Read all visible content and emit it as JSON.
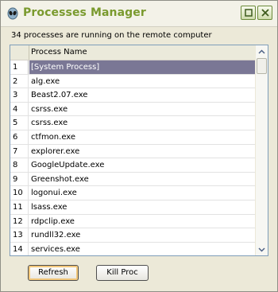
{
  "window": {
    "title": "Processes Manager",
    "icon": "alien-icon",
    "controls": {
      "minimize": "minimize-icon",
      "close": "close-icon"
    }
  },
  "status_text": "34 processes are running on the remote computer",
  "list": {
    "columns": [
      "",
      "Process Name"
    ],
    "selected_index": 0,
    "rows": [
      {
        "num": "1",
        "name": "[System Process]"
      },
      {
        "num": "2",
        "name": "alg.exe"
      },
      {
        "num": "3",
        "name": "Beast2.07.exe"
      },
      {
        "num": "4",
        "name": "csrss.exe"
      },
      {
        "num": "5",
        "name": "csrss.exe"
      },
      {
        "num": "6",
        "name": "ctfmon.exe"
      },
      {
        "num": "7",
        "name": "explorer.exe"
      },
      {
        "num": "8",
        "name": "GoogleUpdate.exe"
      },
      {
        "num": "9",
        "name": "Greenshot.exe"
      },
      {
        "num": "10",
        "name": "logonui.exe"
      },
      {
        "num": "11",
        "name": "lsass.exe"
      },
      {
        "num": "12",
        "name": "rdpclip.exe"
      },
      {
        "num": "13",
        "name": "rundll32.exe"
      },
      {
        "num": "14",
        "name": "services.exe"
      }
    ]
  },
  "buttons": {
    "refresh": "Refresh",
    "kill": "Kill Proc"
  },
  "colors": {
    "title": "#7a9a2e",
    "selection": "#7a7795",
    "list_border": "#7f9db9"
  }
}
